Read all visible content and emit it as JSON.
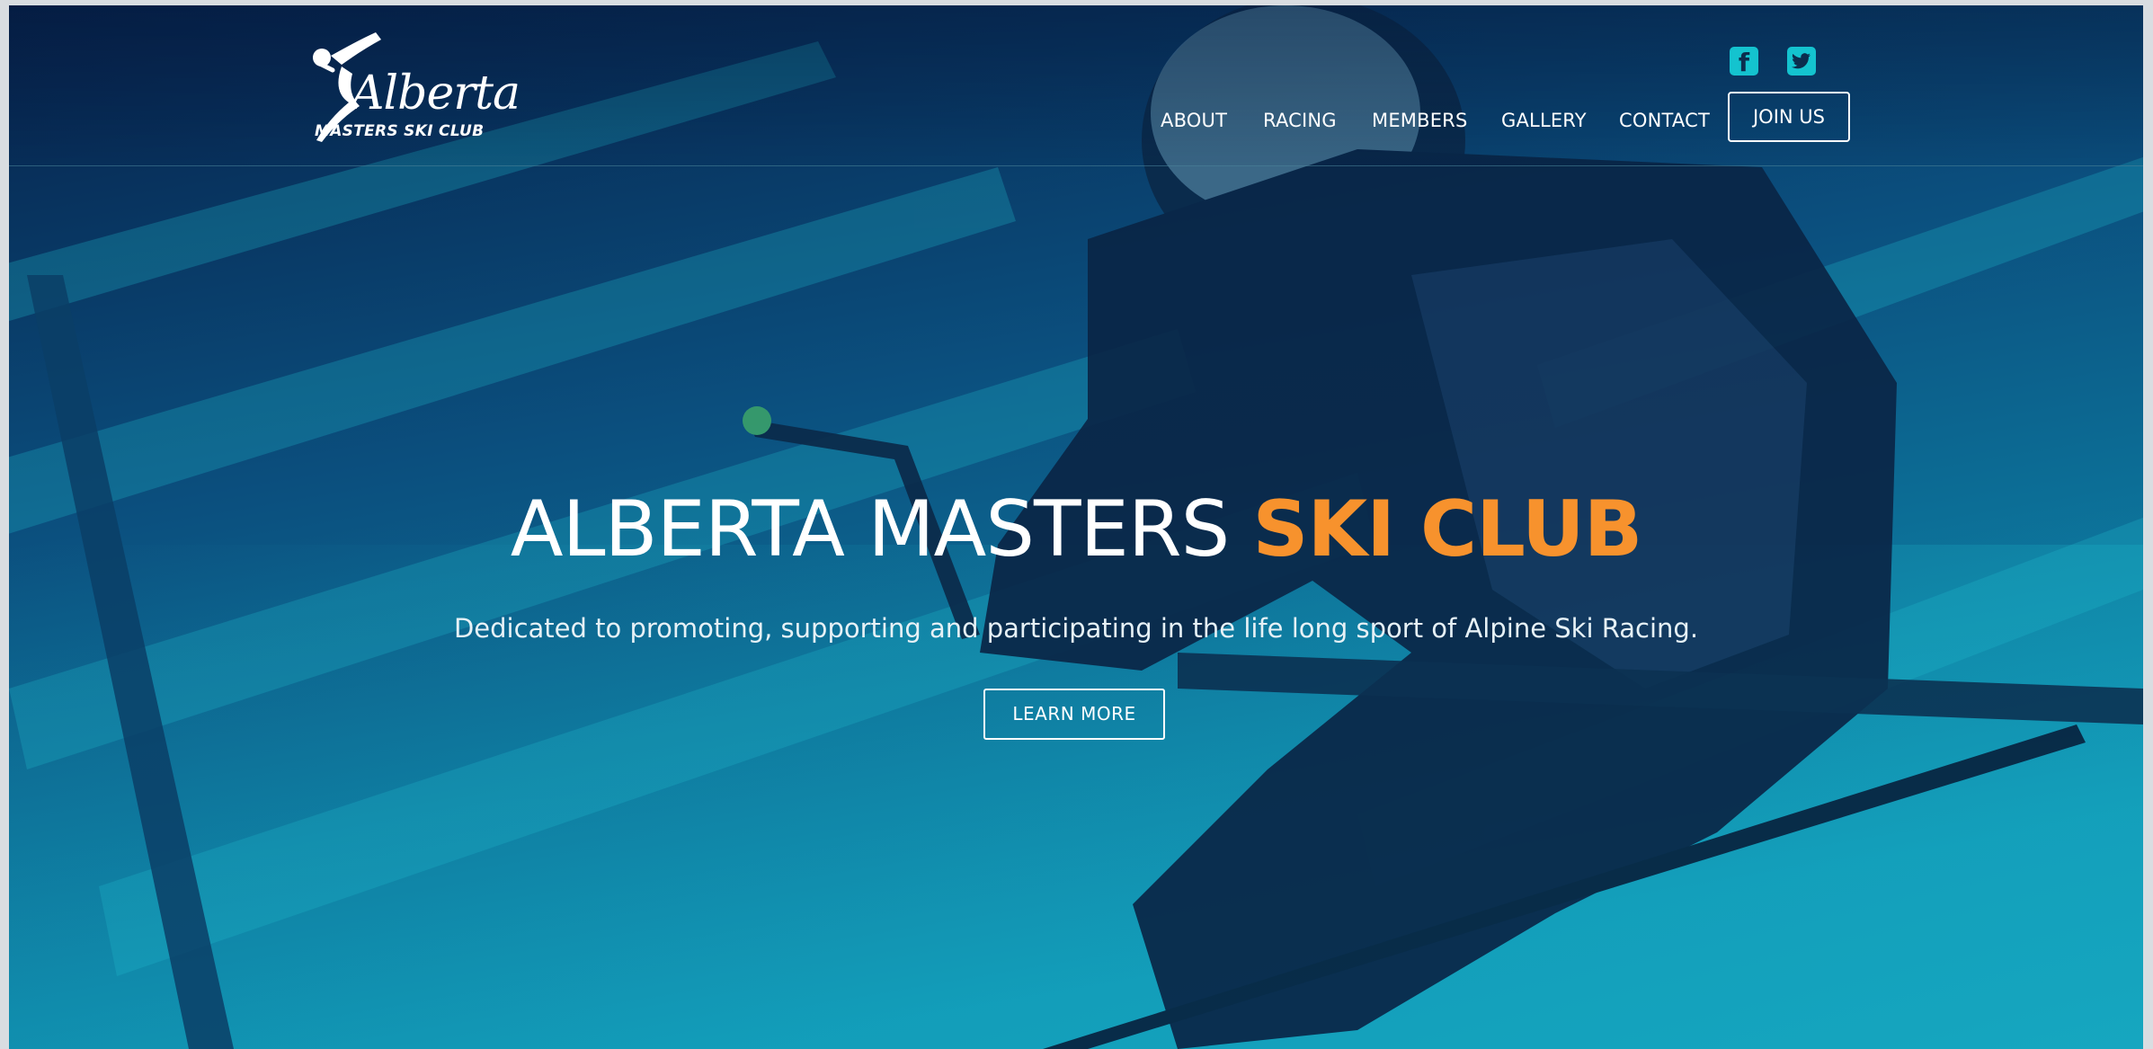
{
  "site": {
    "logo": {
      "word": "Alberta",
      "subtitle": "MASTERS SKI CLUB"
    },
    "social": [
      {
        "network": "facebook",
        "icon": "facebook-icon",
        "glyph": "f"
      },
      {
        "network": "twitter",
        "icon": "twitter-icon"
      }
    ],
    "nav": {
      "items": [
        {
          "label": "ABOUT"
        },
        {
          "label": "RACING"
        },
        {
          "label": "MEMBERS"
        },
        {
          "label": "GALLERY"
        },
        {
          "label": "CONTACT"
        }
      ],
      "cta_label": "JOIN US"
    }
  },
  "hero": {
    "title_light": "ALBERTA MASTERS ",
    "title_accent": "SKI CLUB",
    "tagline": "Dedicated to promoting, supporting and participating in the life long sport of Alpine Ski Racing.",
    "button_label": "LEARN MORE"
  },
  "colors": {
    "accent": "#f7922d",
    "social": "#14c3cf",
    "overlay_dark": "#06214a",
    "overlay_teal": "#0e8fb0"
  }
}
